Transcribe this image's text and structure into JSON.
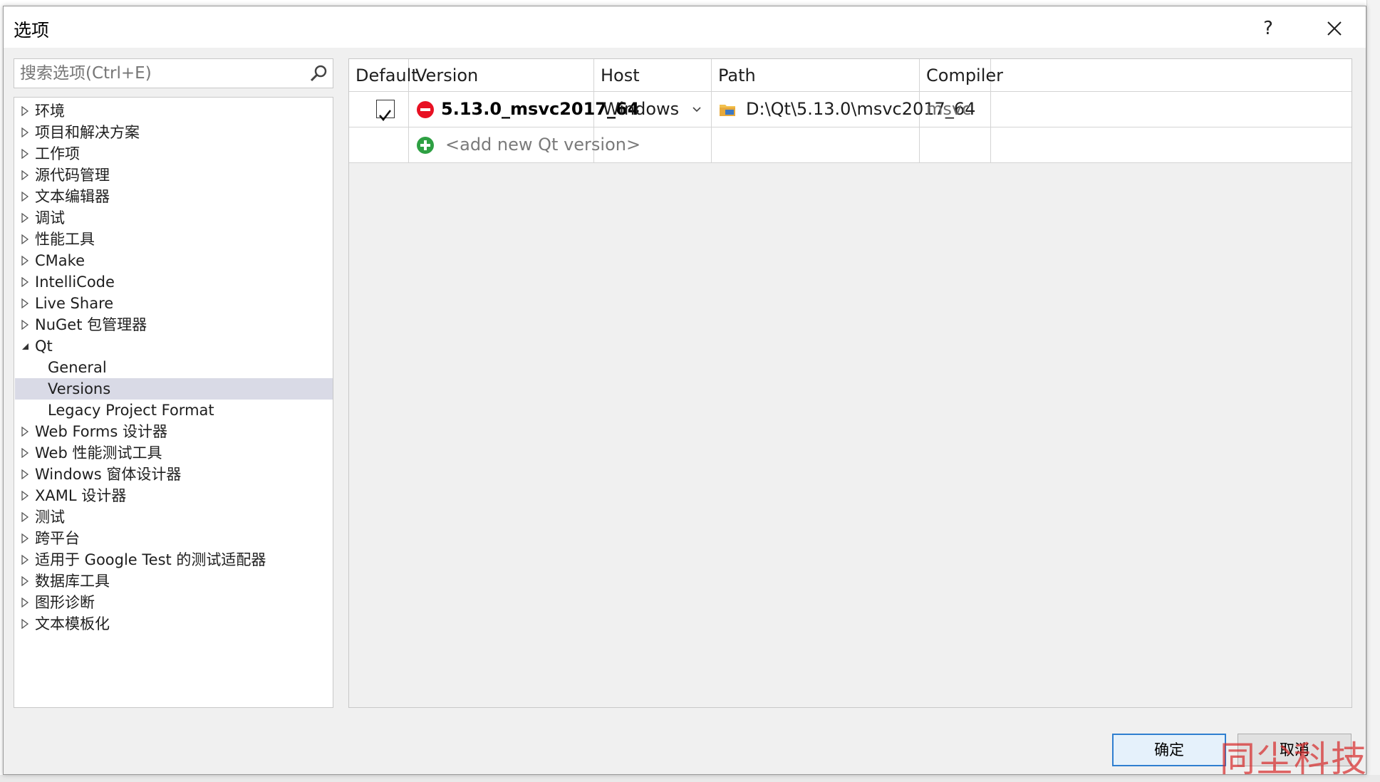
{
  "window": {
    "title": "选项",
    "help_label": "?"
  },
  "search": {
    "placeholder": "搜索选项(Ctrl+E)"
  },
  "tree": {
    "items": [
      {
        "label": "环境",
        "state": "collapsed"
      },
      {
        "label": "项目和解决方案",
        "state": "collapsed"
      },
      {
        "label": "工作项",
        "state": "collapsed"
      },
      {
        "label": "源代码管理",
        "state": "collapsed"
      },
      {
        "label": "文本编辑器",
        "state": "collapsed"
      },
      {
        "label": "调试",
        "state": "collapsed"
      },
      {
        "label": "性能工具",
        "state": "collapsed"
      },
      {
        "label": "CMake",
        "state": "collapsed"
      },
      {
        "label": "IntelliCode",
        "state": "collapsed"
      },
      {
        "label": "Live Share",
        "state": "collapsed"
      },
      {
        "label": "NuGet 包管理器",
        "state": "collapsed"
      },
      {
        "label": "Qt",
        "state": "expanded"
      },
      {
        "label": "General",
        "state": "child"
      },
      {
        "label": "Versions",
        "state": "child",
        "selected": true
      },
      {
        "label": "Legacy Project Format",
        "state": "child"
      },
      {
        "label": "Web Forms 设计器",
        "state": "collapsed"
      },
      {
        "label": "Web 性能测试工具",
        "state": "collapsed"
      },
      {
        "label": "Windows 窗体设计器",
        "state": "collapsed"
      },
      {
        "label": "XAML 设计器",
        "state": "collapsed"
      },
      {
        "label": "测试",
        "state": "collapsed"
      },
      {
        "label": "跨平台",
        "state": "collapsed"
      },
      {
        "label": "适用于 Google Test 的测试适配器",
        "state": "collapsed"
      },
      {
        "label": "数据库工具",
        "state": "collapsed"
      },
      {
        "label": "图形诊断",
        "state": "collapsed"
      },
      {
        "label": "文本模板化",
        "state": "collapsed"
      }
    ]
  },
  "grid": {
    "columns": [
      "Default",
      "Version",
      "Host",
      "Path",
      "Compiler"
    ],
    "rows": [
      {
        "default_checked": true,
        "version": "5.13.0_msvc2017_64",
        "host": "Windows",
        "path": "D:\\Qt\\5.13.0\\msvc2017_64",
        "compiler": "msvc"
      }
    ],
    "add_label": "<add new Qt version>"
  },
  "buttons": {
    "ok": "确定",
    "cancel": "取消"
  },
  "watermark": "同尘科技",
  "colors": {
    "selection": "#d9dae6",
    "remove_red": "#e81123",
    "add_green": "#2ea043",
    "primary_border": "#2f7fd0"
  }
}
